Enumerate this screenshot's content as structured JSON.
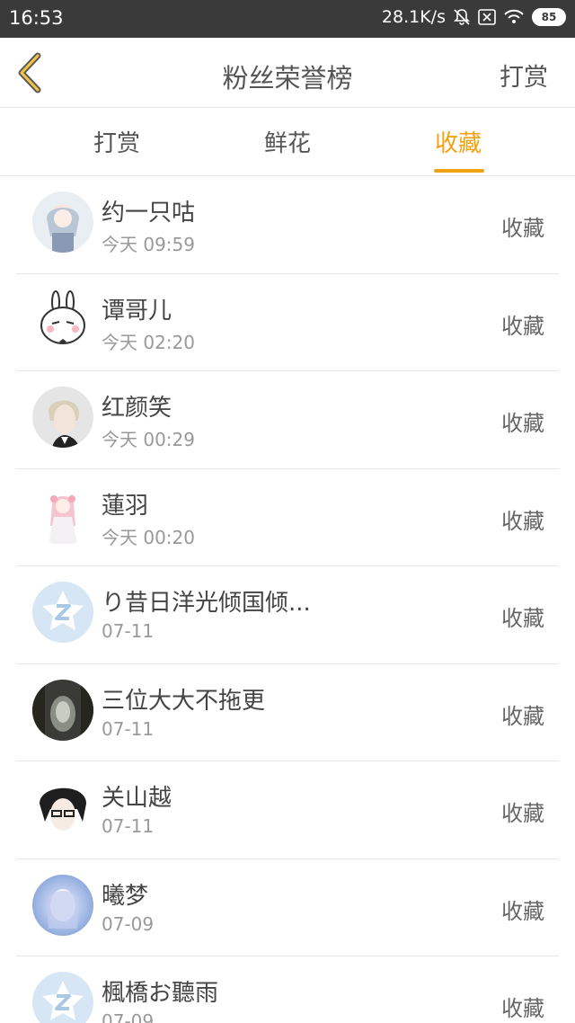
{
  "status_bar": {
    "time": "16:53",
    "network_speed": "28.1K/s",
    "battery": "85",
    "icons": [
      "bell-off-icon",
      "sim-off-icon",
      "wifi-icon",
      "battery-icon"
    ]
  },
  "header": {
    "title": "粉丝荣誉榜",
    "right_action": "打赏",
    "back_icon": "chevron-left-icon"
  },
  "tabs": [
    {
      "label": "打赏",
      "active": false
    },
    {
      "label": "鲜花",
      "active": false
    },
    {
      "label": "收藏",
      "active": true
    }
  ],
  "accent_color": "#f1a212",
  "fans": [
    {
      "name": "约一只咕",
      "time": "今天 09:59",
      "action": "收藏",
      "avatar": "anime-girl-avatar"
    },
    {
      "name": "谭哥儿",
      "time": "今天 02:20",
      "action": "收藏",
      "avatar": "rabbit-avatar"
    },
    {
      "name": "红颜笑",
      "time": "今天 00:29",
      "action": "收藏",
      "avatar": "blond-man-avatar"
    },
    {
      "name": "蓮羽",
      "time": "今天 00:20",
      "action": "收藏",
      "avatar": "pink-hair-girl-avatar"
    },
    {
      "name": "り昔日洋光倾国倾...",
      "time": "07-11",
      "action": "收藏",
      "avatar": "default-qq-avatar"
    },
    {
      "name": "三位大大不拖更",
      "time": "07-11",
      "action": "收藏",
      "avatar": "dark-photo-avatar"
    },
    {
      "name": "关山越",
      "time": "07-11",
      "action": "收藏",
      "avatar": "glasses-anime-avatar"
    },
    {
      "name": "曦梦",
      "time": "07-09",
      "action": "收藏",
      "avatar": "blue-anime-avatar"
    },
    {
      "name": "楓橋お聽雨",
      "time": "07-09",
      "action": "收藏",
      "avatar": "default-qq-avatar"
    }
  ]
}
